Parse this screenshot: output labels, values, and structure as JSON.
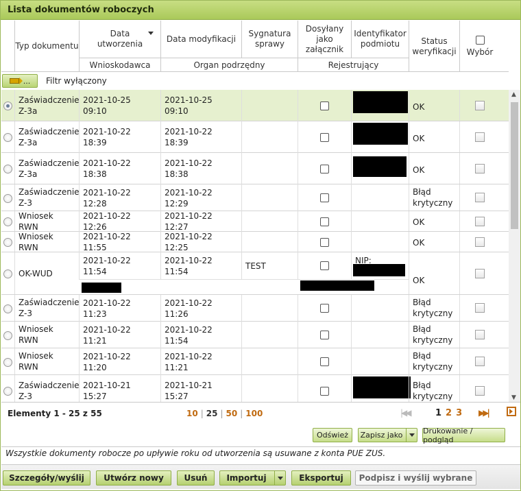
{
  "title": "Lista dokumentów roboczych",
  "headers": {
    "typ": "Typ dokumentu",
    "data_utw": "Data utworzenia",
    "data_mod": "Data modyfikacji",
    "sygnatura": "Sygnatura sprawy",
    "dosylany": "Dosyłany jako załącznik",
    "identyfikator": "Identyfikator podmiotu",
    "status": "Status weryfikacji",
    "wybor": "Wybór",
    "wnioskodawca": "Wnioskodawca",
    "organ": "Organ podrzędny",
    "rejestrujacy": "Rejestrujący"
  },
  "filter": {
    "button_label": "...",
    "status_text": "Filtr wyłączony"
  },
  "rows": [
    {
      "typ": "Zaświadczenie Z-3a",
      "utw": "2021-10-25 09:10",
      "mod": "2021-10-25 09:10",
      "syg": "",
      "status": "OK",
      "selected": true
    },
    {
      "typ": "Zaświadczenie Z-3a",
      "utw": "2021-10-22 18:39",
      "mod": "2021-10-22 18:39",
      "syg": "",
      "status": "OK",
      "selected": false
    },
    {
      "typ": "Zaświadczenie Z-3a",
      "utw": "2021-10-22 18:38",
      "mod": "2021-10-22 18:38",
      "syg": "",
      "status": "OK",
      "selected": false
    },
    {
      "typ": "Zaświadczenie Z-3",
      "utw": "2021-10-22 12:28",
      "mod": "2021-10-22 12:29",
      "syg": "",
      "status": "Błąd krytyczny",
      "selected": false
    },
    {
      "typ": "Wniosek RWN",
      "utw": "2021-10-22 12:26",
      "mod": "2021-10-22 12:27",
      "syg": "",
      "status": "OK",
      "selected": false
    },
    {
      "typ": "Wniosek RWN",
      "utw": "2021-10-22 11:55",
      "mod": "2021-10-22 12:25",
      "syg": "",
      "status": "OK",
      "selected": false
    },
    {
      "typ": "OK-WUD",
      "utw": "2021-10-22 11:54",
      "mod": "2021-10-22 11:54",
      "syg": "TEST",
      "status": "OK",
      "nip_label": "NIP:",
      "selected": false
    },
    {
      "typ": "Zaświadczenie Z-3",
      "utw": "2021-10-22 11:23",
      "mod": "2021-10-22 11:26",
      "syg": "",
      "status": "Błąd krytyczny",
      "selected": false
    },
    {
      "typ": "Wniosek RWN",
      "utw": "2021-10-22 11:21",
      "mod": "2021-10-22 11:54",
      "syg": "",
      "status": "Błąd krytyczny",
      "selected": false
    },
    {
      "typ": "Wniosek RWN",
      "utw": "2021-10-22 11:20",
      "mod": "2021-10-22 11:21",
      "syg": "",
      "status": "Błąd krytyczny",
      "selected": false
    },
    {
      "typ": "Zaświadczenie Z-3",
      "utw": "2021-10-21 15:27",
      "mod": "2021-10-21 15:27",
      "syg": "",
      "status": "Błąd krytyczny",
      "selected": false
    }
  ],
  "pager": {
    "elements": "Elementy 1 - 25 z 55",
    "size_10": "10",
    "size_25": "25",
    "size_50": "50",
    "size_100": "100",
    "page_1": "1",
    "page_2": "2",
    "page_3": "3"
  },
  "actions": {
    "odswiez": "Odśwież",
    "zapisz": "Zapisz jako",
    "drukowanie": "Drukowanie / podgląd"
  },
  "info": "Wszystkie dokumenty robocze po upływie roku od utworzenia są usuwane z konta PUE ZUS.",
  "bottom": {
    "szczegoly": "Szczegóły/wyślij",
    "utworz": "Utwórz nowy",
    "usun": "Usuń",
    "importuj": "Importuj",
    "eksportuj": "Eksportuj",
    "podpisz": "Podpisz i wyślij wybrane"
  }
}
